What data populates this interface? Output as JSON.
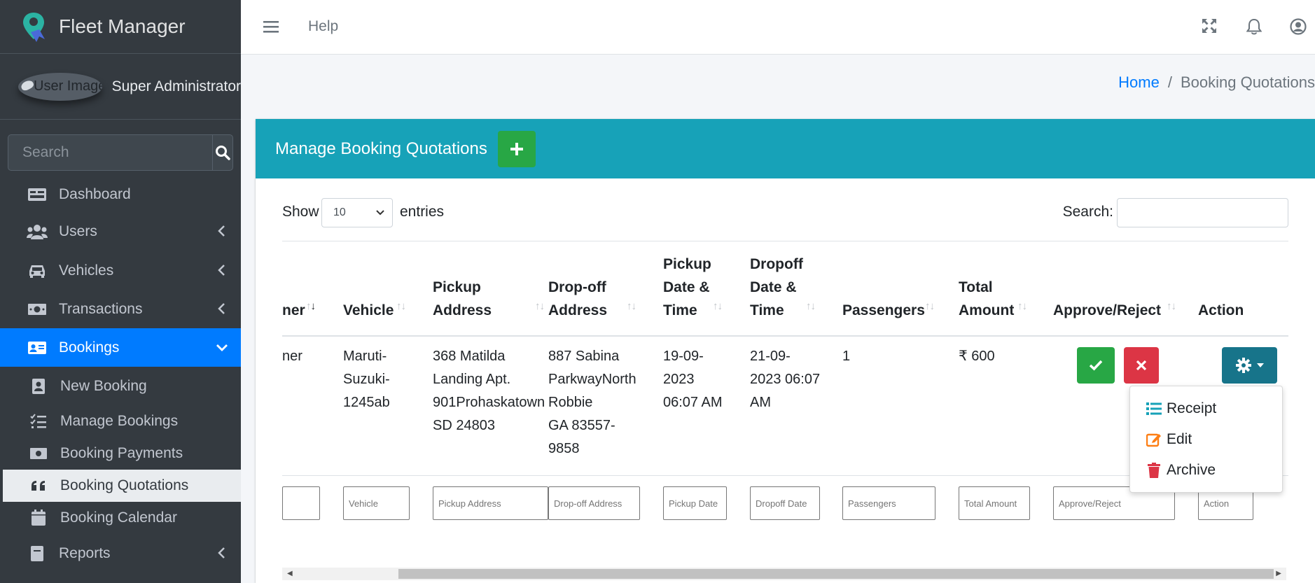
{
  "brand": {
    "name": "Fleet Manager",
    "accent": "#17a2b8"
  },
  "user": {
    "image_alt": "User Image",
    "name": "Super Administrator"
  },
  "sidebar": {
    "search_placeholder": "Search",
    "items": [
      {
        "label": "Dashboard",
        "icon": "dashboard-icon"
      },
      {
        "label": "Users",
        "icon": "users-icon"
      },
      {
        "label": "Vehicles",
        "icon": "car-icon"
      },
      {
        "label": "Transactions",
        "icon": "money-icon"
      },
      {
        "label": "Bookings",
        "icon": "address-card-icon"
      },
      {
        "label": "Reports",
        "icon": "report-icon"
      }
    ],
    "sub_items": [
      {
        "label": "New Booking"
      },
      {
        "label": "Manage Bookings"
      },
      {
        "label": "Booking Payments"
      },
      {
        "label": "Booking Quotations"
      },
      {
        "label": "Booking Calendar"
      }
    ]
  },
  "topbar": {
    "help": "Help"
  },
  "breadcrumb": {
    "home": "Home",
    "separator": "/",
    "current": "Booking Quotations"
  },
  "card": {
    "title": "Manage Booking Quotations"
  },
  "table_controls": {
    "show": "Show",
    "page_length": "10",
    "entries": "entries",
    "search_label": "Search:"
  },
  "table": {
    "columns": {
      "customer": "ner",
      "vehicle": "Vehicle",
      "pickup_addr_1": "Pickup",
      "pickup_addr_2": "Address",
      "dropoff_addr_1": "Drop-off",
      "dropoff_addr_2": "Address",
      "pickup_time_1": "Pickup",
      "pickup_time_2": "Date &",
      "pickup_time_3": "Time",
      "dropoff_time_1": "Dropoff",
      "dropoff_time_2": "Date &",
      "dropoff_time_3": "Time",
      "passengers": "Passengers",
      "amount_1": "Total",
      "amount_2": "Amount",
      "approve": "Approve/Reject",
      "action": "Action"
    },
    "row": {
      "customer": "ner",
      "vehicle": [
        "Maruti-",
        "Suzuki-",
        "1245ab"
      ],
      "pickup": [
        "368 Matilda",
        "Landing Apt.",
        "901Prohaskatown",
        "SD 24803"
      ],
      "dropoff": [
        "887 Sabina",
        "ParkwayNorth",
        "Robbie",
        "GA 83557-",
        "9858"
      ],
      "pickup_time": [
        "19-09-",
        "2023",
        "06:07 AM"
      ],
      "dropoff_time": [
        "21-09-",
        "2023 06:07",
        "AM"
      ],
      "passengers": "1",
      "amount": "₹ 600"
    },
    "filters": {
      "vehicle": "Vehicle",
      "pickup": "Pickup Address",
      "dropoff": "Drop-off Address",
      "pickup_date": "Pickup Date",
      "dropoff_date": "Dropoff Date",
      "passengers": "Passengers",
      "amount": "Total Amount",
      "approve": "Approve/Reject",
      "action": "Action"
    }
  },
  "action_menu": [
    {
      "label": "Receipt",
      "icon": "list-icon",
      "color": "#17a2b8"
    },
    {
      "label": "Edit",
      "icon": "edit-icon",
      "color": "#fd7e14"
    },
    {
      "label": "Archive",
      "icon": "trash-icon",
      "color": "#dc3545"
    }
  ]
}
